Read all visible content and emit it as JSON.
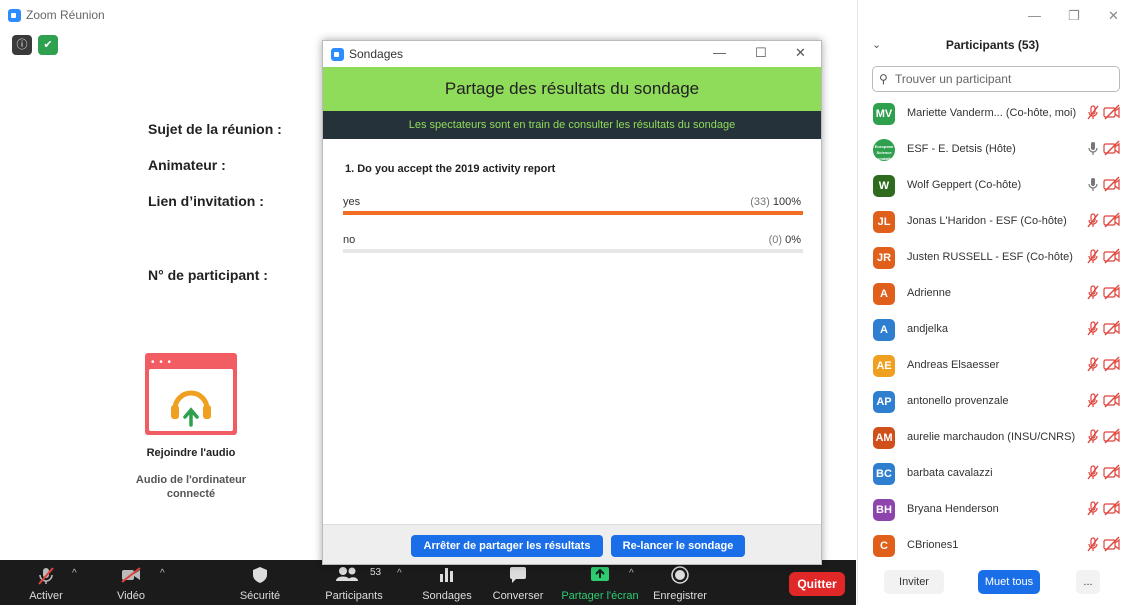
{
  "window": {
    "title": "Zoom Réunion"
  },
  "meeting_info": {
    "topic_label": "Sujet de la réunion :",
    "host_label": "Animateur :",
    "invite_label": "Lien d’invitation :",
    "participant_id_label": "N° de participant :"
  },
  "audio": {
    "join_label": "Rejoindre l'audio",
    "status_label": "Audio de l'ordinateur connecté"
  },
  "toolbar": {
    "activate": "Activer",
    "video": "Vidéo",
    "security": "Sécurité",
    "participants": "Participants",
    "participants_count": "53",
    "polls": "Sondages",
    "chat": "Converser",
    "share": "Partager l'écran",
    "record": "Enregistrer",
    "quit": "Quitter"
  },
  "poll_dialog": {
    "window_title": "Sondages",
    "header": "Partage des résultats du sondage",
    "subheader": "Les spectateurs sont en train de consulter les résultats du sondage",
    "question": "1. Do you accept the 2019 activity report",
    "answers": [
      {
        "label": "yes",
        "count": "(33)",
        "percent": "100%",
        "fraction": 1.0
      },
      {
        "label": "no",
        "count": "(0)",
        "percent": "0%",
        "fraction": 0.0
      }
    ],
    "stop_sharing_button": "Arrêter de partager les résultats",
    "relaunch_button": "Re-lancer le sondage"
  },
  "participants_panel": {
    "title": "Participants (53)",
    "search_placeholder": "Trouver un participant",
    "participants": [
      {
        "initials": "MV",
        "name": "Mariette Vanderm... (Co-hôte, moi)",
        "color": "#2ea04e",
        "mic": "muted"
      },
      {
        "initials": "ESF",
        "name": "ESF - E. Detsis (Hôte)",
        "color": "#2ea04e",
        "mic": "on",
        "logo_text": "European Science Foundation"
      },
      {
        "initials": "W",
        "name": "Wolf Geppert (Co-hôte)",
        "color": "#2f6b1e",
        "mic": "on"
      },
      {
        "initials": "JL",
        "name": "Jonas L'Haridon - ESF (Co-hôte)",
        "color": "#e0601b",
        "mic": "muted"
      },
      {
        "initials": "JR",
        "name": "Justen RUSSELL - ESF (Co-hôte)",
        "color": "#e0601b",
        "mic": "muted"
      },
      {
        "initials": "A",
        "name": "Adrienne",
        "color": "#e0601b",
        "mic": "muted"
      },
      {
        "initials": "A",
        "name": "andjelka",
        "color": "#2f7fd0",
        "mic": "muted"
      },
      {
        "initials": "AE",
        "name": "Andreas Elsaesser",
        "color": "#f0a020",
        "mic": "muted"
      },
      {
        "initials": "AP",
        "name": "antonello provenzale",
        "color": "#2f7fd0",
        "mic": "muted"
      },
      {
        "initials": "AM",
        "name": "aurelie marchaudon (INSU/CNRS)",
        "color": "#d0501b",
        "mic": "muted"
      },
      {
        "initials": "BC",
        "name": "barbata cavalazzi",
        "color": "#2f7fd0",
        "mic": "muted"
      },
      {
        "initials": "BH",
        "name": "Bryana Henderson",
        "color": "#8e44ad",
        "mic": "muted"
      },
      {
        "initials": "C",
        "name": "CBriones1",
        "color": "#e0601b",
        "mic": "muted"
      }
    ],
    "invite_button": "Inviter",
    "mute_all_button": "Muet tous",
    "more_button": "..."
  }
}
